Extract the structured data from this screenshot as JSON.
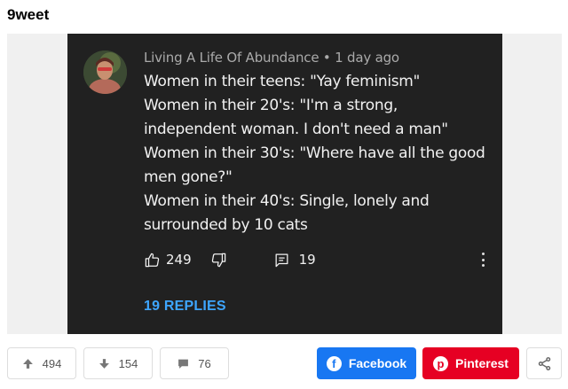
{
  "post": {
    "title": "9weet"
  },
  "comment": {
    "author_line": "Living A Life Of Abundance • 1 day ago",
    "lines": [
      "Women in their teens: \"Yay feminism\"",
      "Women in their 20's: \"I'm a strong, independent woman. I don't need a man\"",
      "Women in their 30's: \"Where have all the good men gone?\"",
      "Women in their 40's: Single, lonely and surrounded by 10 cats"
    ],
    "likes": "249",
    "replies": "19",
    "replies_link": "19 REPLIES",
    "icons": {
      "like": "thumbs-up-icon",
      "dislike": "thumbs-down-icon",
      "reply": "comment-icon",
      "more": "vertical-dots-icon"
    }
  },
  "actions": {
    "upvotes": "494",
    "downvotes": "154",
    "comments": "76",
    "facebook_label": "Facebook",
    "pinterest_label": "Pinterest",
    "icons": {
      "upvote": "arrow-up-icon",
      "downvote": "arrow-down-icon",
      "comments": "speech-bubble-icon",
      "facebook": "facebook-icon",
      "pinterest": "pinterest-icon",
      "share": "share-icon"
    }
  },
  "colors": {
    "screenshot_bg": "#212121",
    "link_blue": "#3ea6ff",
    "facebook": "#1877f2",
    "pinterest": "#e60023"
  }
}
